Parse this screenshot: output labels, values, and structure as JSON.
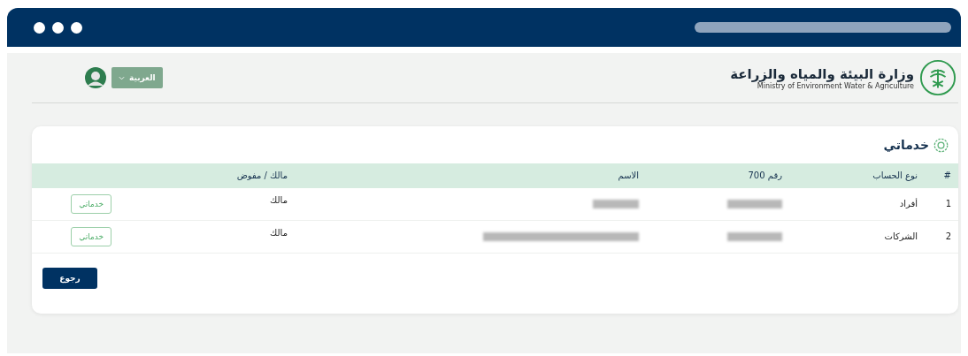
{
  "header": {
    "title": "وزارة البيئة والمياه والزراعة",
    "subtitle": "Ministry of Environment Water & Agriculture",
    "language": "العربية"
  },
  "card": {
    "title": "خدماتي",
    "table": {
      "columns": [
        "#",
        "نوع الحساب",
        "رقم 700",
        "الاسم",
        "مالك / مفوض"
      ],
      "rows": [
        {
          "index": "1",
          "account_type": "أفراد",
          "role": "مالك",
          "action": "خدماتي"
        },
        {
          "index": "2",
          "account_type": "الشركات",
          "role": "مالك",
          "action": "خدماتي"
        }
      ]
    },
    "back_button": "رجوع"
  }
}
